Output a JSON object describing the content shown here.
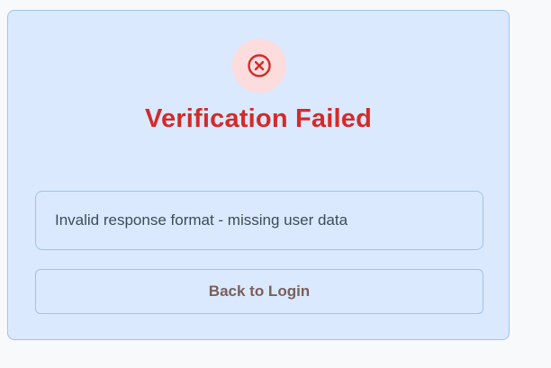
{
  "status": {
    "icon": "x-circle-icon",
    "icon_color": "#d42a2a",
    "icon_bg": "#fcdcdc",
    "title": "Verification Failed",
    "title_color": "#d42a2a"
  },
  "error": {
    "message": "Invalid response format - missing user data"
  },
  "actions": {
    "back_label": "Back to Login"
  },
  "colors": {
    "card_bg": "#dbe9fe",
    "border": "#9ec3ec",
    "page_bg": "#f8f9fb"
  }
}
